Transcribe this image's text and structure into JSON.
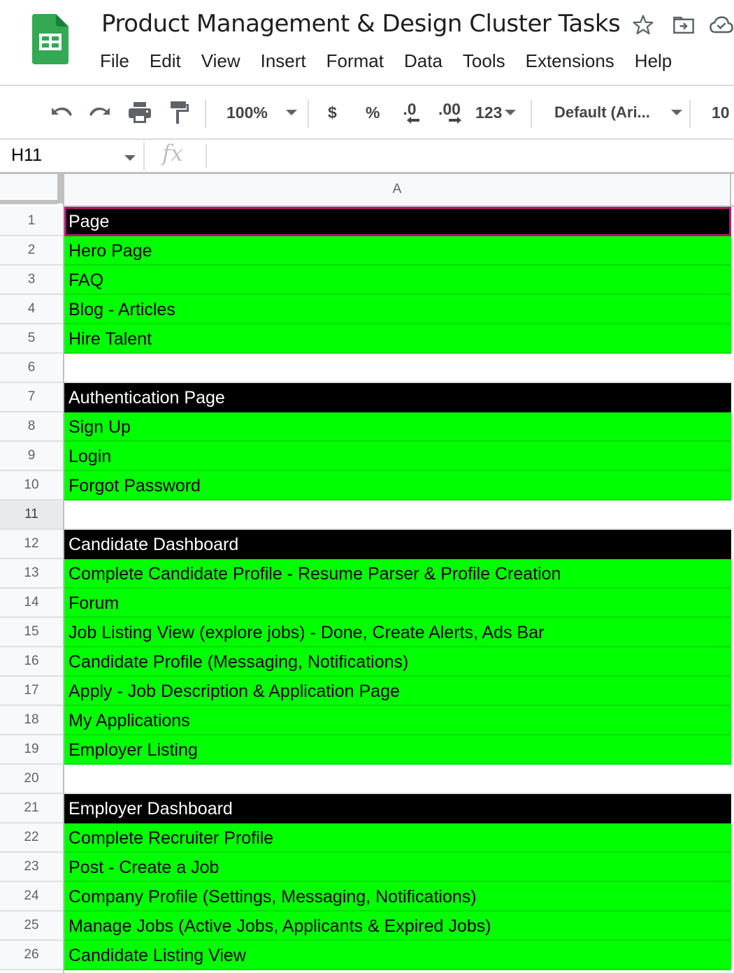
{
  "app": {
    "doc_title": "Product Management & Design Cluster Tasks",
    "menu": [
      "File",
      "Edit",
      "View",
      "Insert",
      "Format",
      "Data",
      "Tools",
      "Extensions",
      "Help"
    ],
    "title_icons": [
      "star-icon",
      "move-to-folder-icon",
      "cloud-saved-icon"
    ]
  },
  "toolbar": {
    "zoom": "100%",
    "currency": "$",
    "percent": "%",
    "decrease_decimal": ".0",
    "increase_decimal": ".00",
    "number_format": "123",
    "font": "Default (Ari...",
    "font_size": "10"
  },
  "formula_bar": {
    "name_box": "H11",
    "fx_label": "fx",
    "value": ""
  },
  "sheet": {
    "column_header": "A",
    "selected_row": 11,
    "active_cell_row": 1,
    "colors": {
      "header_bg": "#000000",
      "task_bg": "#00ff00",
      "active_border": "#b0176e"
    },
    "rows": [
      {
        "num": "1",
        "text": "Page",
        "type": "header"
      },
      {
        "num": "2",
        "text": "Hero Page",
        "type": "task"
      },
      {
        "num": "3",
        "text": "FAQ",
        "type": "task"
      },
      {
        "num": "4",
        "text": "Blog - Articles",
        "type": "task"
      },
      {
        "num": "5",
        "text": "Hire Talent",
        "type": "task"
      },
      {
        "num": "6",
        "text": "",
        "type": "empty"
      },
      {
        "num": "7",
        "text": "Authentication Page",
        "type": "header"
      },
      {
        "num": "8",
        "text": "Sign Up",
        "type": "task"
      },
      {
        "num": "9",
        "text": "Login",
        "type": "task"
      },
      {
        "num": "10",
        "text": "Forgot Password",
        "type": "task"
      },
      {
        "num": "11",
        "text": "",
        "type": "empty"
      },
      {
        "num": "12",
        "text": "Candidate Dashboard",
        "type": "header"
      },
      {
        "num": "13",
        "text": "Complete Candidate Profile - Resume Parser & Profile Creation",
        "type": "task"
      },
      {
        "num": "14",
        "text": "Forum",
        "type": "task"
      },
      {
        "num": "15",
        "text": "Job Listing View (explore jobs) - Done, Create Alerts, Ads Bar",
        "type": "task"
      },
      {
        "num": "16",
        "text": "Candidate Profile (Messaging, Notifications)",
        "type": "task"
      },
      {
        "num": "17",
        "text": "Apply - Job Description & Application Page",
        "type": "task"
      },
      {
        "num": "18",
        "text": "My Applications",
        "type": "task"
      },
      {
        "num": "19",
        "text": "Employer Listing",
        "type": "task"
      },
      {
        "num": "20",
        "text": "",
        "type": "empty"
      },
      {
        "num": "21",
        "text": "Employer Dashboard",
        "type": "header"
      },
      {
        "num": "22",
        "text": "Complete Recruiter Profile",
        "type": "task"
      },
      {
        "num": "23",
        "text": "Post - Create a Job",
        "type": "task"
      },
      {
        "num": "24",
        "text": "Company Profile (Settings, Messaging, Notifications)",
        "type": "task"
      },
      {
        "num": "25",
        "text": "Manage Jobs (Active Jobs, Applicants & Expired Jobs)",
        "type": "task"
      },
      {
        "num": "26",
        "text": "Candidate Listing View",
        "type": "task"
      }
    ]
  }
}
